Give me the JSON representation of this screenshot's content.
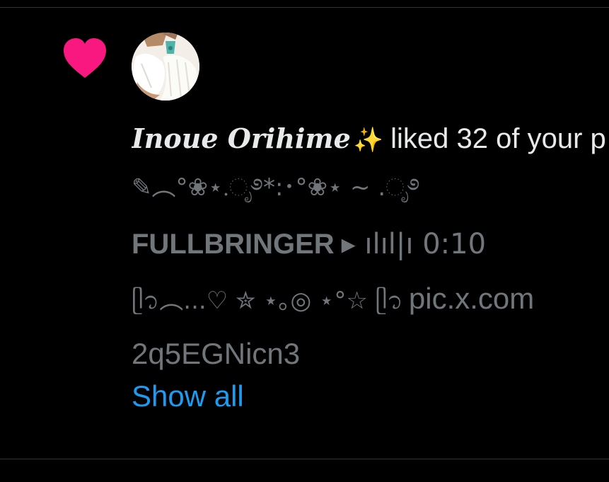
{
  "notification": {
    "actor_name": "Inoue Orihime",
    "actor_emoji": "✨",
    "action_text": "liked 32 of your p",
    "post_preview": {
      "line_1": "✎︵°❀⋆.ೃ࿔*:･°❀⋆ ~ .ೃ࿔",
      "line_2_title": "FULLBRINGER",
      "line_2_rest": "▸ ılıl|ı 0:10",
      "line_3_deco": "ᥫ᭡︵...♡ ✮ ⋆｡◎ ⋆°☆ ᥫ᭡",
      "line_3_link": "pic.x.com",
      "line_4": "2q5EGNicn3"
    },
    "show_all_label": "Show all"
  },
  "icons": {
    "notification_type": "heart-icon",
    "heart_color": "#f91880"
  },
  "colors": {
    "background": "#000000",
    "primary_text": "#e7e9ea",
    "secondary_text": "#71767b",
    "link": "#1d9bf0",
    "divider": "#2f3336"
  }
}
